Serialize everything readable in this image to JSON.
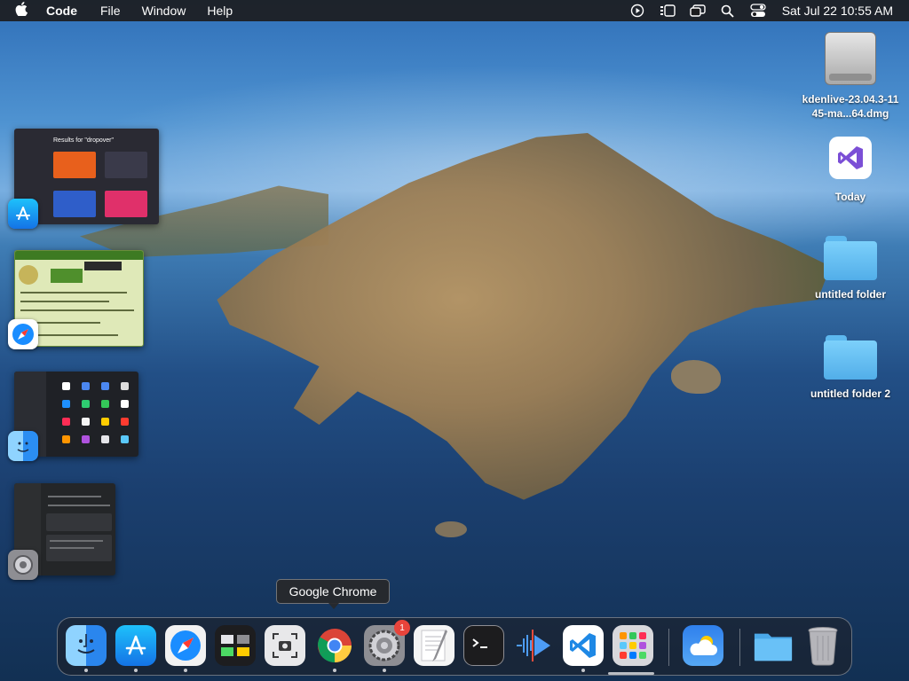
{
  "menubar": {
    "app_name": "Code",
    "menus": [
      "File",
      "Window",
      "Help"
    ],
    "clock": "Sat Jul 22  10:55 AM"
  },
  "desktop": {
    "items": [
      {
        "label": "kdenlive-23.04.3-1145-ma...64.dmg",
        "icon": "disk-image-icon"
      },
      {
        "label": "Today",
        "icon": "visual-studio-icon"
      },
      {
        "label": "untitled folder",
        "icon": "folder-icon"
      },
      {
        "label": "untitled folder 2",
        "icon": "folder-icon"
      }
    ]
  },
  "windows": {
    "appstore_title": "Results for \"dropover\""
  },
  "tooltip": "Google Chrome",
  "dock": {
    "items": [
      {
        "name": "Finder",
        "icon": "finder-icon",
        "running": true
      },
      {
        "name": "App Store",
        "icon": "app-store-icon",
        "running": true
      },
      {
        "name": "Safari",
        "icon": "safari-icon",
        "running": true
      },
      {
        "name": "Mission Control",
        "icon": "mission-control-icon",
        "running": false
      },
      {
        "name": "Screenshot",
        "icon": "screenshot-icon",
        "running": false
      },
      {
        "name": "Google Chrome",
        "icon": "chrome-icon",
        "running": true
      },
      {
        "name": "System Settings",
        "icon": "settings-icon",
        "running": true,
        "badge": "1"
      },
      {
        "name": "TextEdit",
        "icon": "textedit-icon",
        "running": false
      },
      {
        "name": "Terminal",
        "icon": "terminal-icon",
        "running": false
      },
      {
        "name": "Kdenlive",
        "icon": "kdenlive-icon",
        "running": false
      },
      {
        "name": "Visual Studio Code",
        "icon": "vscode-icon",
        "running": true
      },
      {
        "name": "Launchpad",
        "icon": "launchpad-icon",
        "running": false
      },
      {
        "name": "Weather",
        "icon": "weather-icon",
        "running": false
      },
      {
        "name": "Downloads",
        "icon": "folder-icon",
        "running": false
      },
      {
        "name": "Trash",
        "icon": "trash-icon",
        "running": false
      }
    ]
  }
}
